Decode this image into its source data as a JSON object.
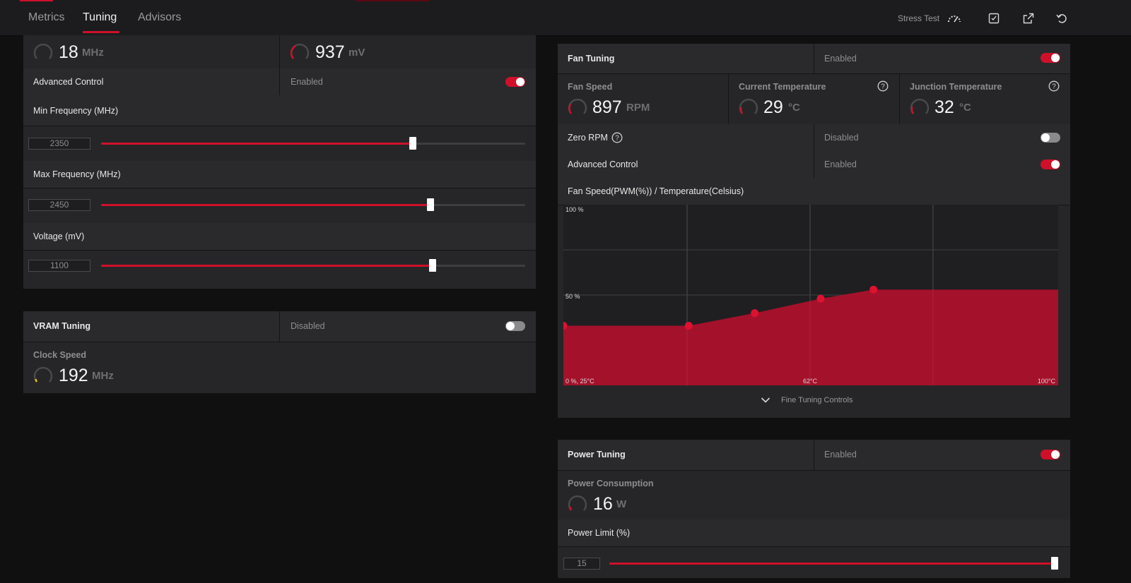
{
  "nav": {
    "tabs": [
      "Metrics",
      "Tuning",
      "Advisors"
    ],
    "active_tab": "Tuning",
    "stress_test_label": "Stress Test",
    "icons": [
      "gauge-icon",
      "save-icon",
      "export-icon",
      "undo-icon"
    ]
  },
  "gpu_panel": {
    "clock_value": "18",
    "clock_unit": "MHz",
    "voltage_value": "937",
    "voltage_unit": "mV",
    "advanced_control_label": "Advanced Control",
    "advanced_control_state": "Enabled",
    "min_freq": {
      "label": "Min Frequency (MHz)",
      "value": "2350",
      "fraction": 0.735
    },
    "max_freq": {
      "label": "Max Frequency (MHz)",
      "value": "2450",
      "fraction": 0.776
    },
    "voltage": {
      "label": "Voltage (mV)",
      "value": "1100",
      "fraction": 0.782
    }
  },
  "vram_panel": {
    "title": "VRAM Tuning",
    "state": "Disabled",
    "clock_title": "Clock Speed",
    "clock_value": "192",
    "clock_unit": "MHz"
  },
  "fan_panel": {
    "title": "Fan Tuning",
    "state": "Enabled",
    "fan_speed_title": "Fan Speed",
    "fan_speed_value": "897",
    "fan_speed_unit": "RPM",
    "current_temp_title": "Current Temperature",
    "current_temp_value": "29",
    "current_temp_unit": "°C",
    "junction_temp_title": "Junction Temperature",
    "junction_temp_value": "32",
    "junction_temp_unit": "°C",
    "zero_rpm_label": "Zero RPM",
    "zero_rpm_state": "Disabled",
    "advanced_control_label": "Advanced Control",
    "advanced_control_state": "Enabled",
    "curve_label": "Fan Speed(PWM(%)) / Temperature(Celsius)",
    "fine_tuning_label": "Fine Tuning Controls"
  },
  "power_panel": {
    "title": "Power Tuning",
    "state": "Enabled",
    "consumption_title": "Power Consumption",
    "consumption_value": "16",
    "consumption_unit": "W",
    "limit_label": "Power Limit (%)",
    "limit_value": "15",
    "limit_fraction": 1.0
  },
  "chart_data": {
    "type": "area",
    "title": "Fan Speed(PWM(%)) / Temperature(Celsius)",
    "x_unit": "°C",
    "y_unit": "%",
    "xlim": [
      25,
      100
    ],
    "ylim": [
      0,
      100
    ],
    "tick_labels": [
      "100 %",
      "50 %",
      "0 %, 25°C",
      "62°C",
      "100°C"
    ],
    "series": [
      {
        "x": [
          25,
          44,
          54,
          64,
          72,
          100
        ],
        "y": [
          33,
          33,
          40,
          48,
          53,
          53
        ]
      }
    ],
    "grid": true,
    "fill_color": "#b0102c",
    "point_color": "#e01030"
  },
  "colors": {
    "accent": "#d0102a",
    "panel": "#262628",
    "background": "#101011"
  }
}
